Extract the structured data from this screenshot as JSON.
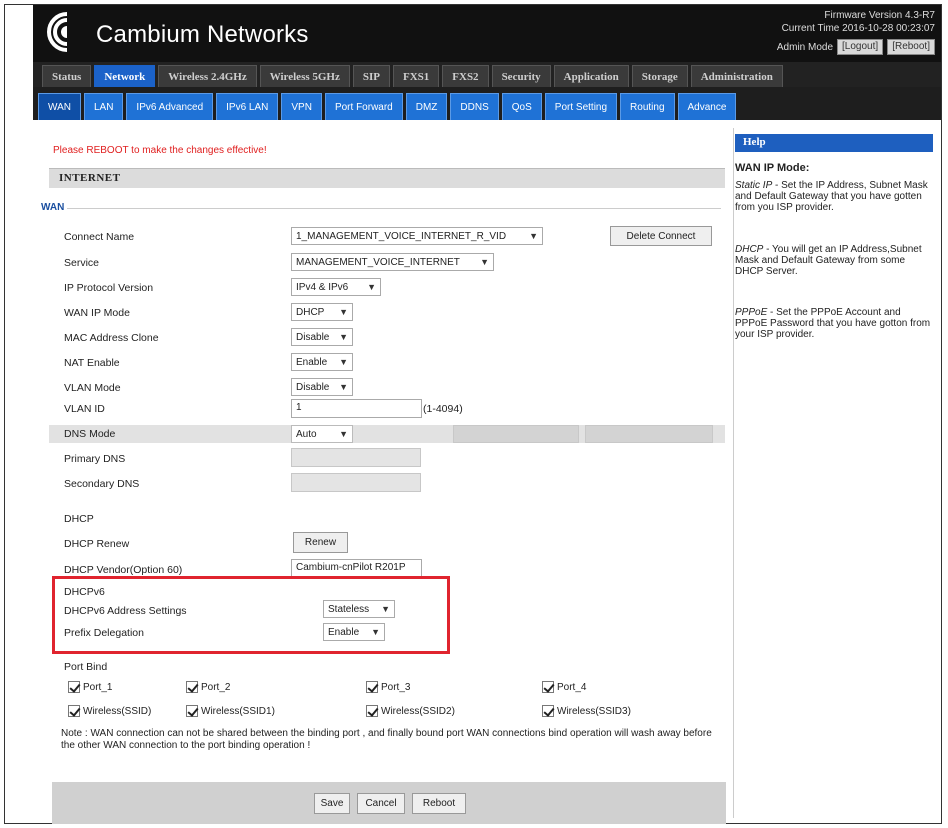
{
  "header": {
    "brand": "Cambium Networks",
    "firmware": "Firmware Version 4.3-R7",
    "current_time": "Current Time 2016-10-28 00:23:07",
    "admin_mode": "Admin Mode",
    "logout_label": "[Logout]",
    "reboot_label": "[Reboot]"
  },
  "main_tabs": [
    {
      "label": "Status",
      "active": false
    },
    {
      "label": "Network",
      "active": true
    },
    {
      "label": "Wireless 2.4GHz",
      "active": false
    },
    {
      "label": "Wireless 5GHz",
      "active": false
    },
    {
      "label": "SIP",
      "active": false
    },
    {
      "label": "FXS1",
      "active": false
    },
    {
      "label": "FXS2",
      "active": false
    },
    {
      "label": "Security",
      "active": false
    },
    {
      "label": "Application",
      "active": false
    },
    {
      "label": "Storage",
      "active": false
    },
    {
      "label": "Administration",
      "active": false
    }
  ],
  "sub_tabs": [
    {
      "label": "WAN",
      "active": true
    },
    {
      "label": "LAN",
      "active": false
    },
    {
      "label": "IPv6 Advanced",
      "active": false
    },
    {
      "label": "IPv6 LAN",
      "active": false
    },
    {
      "label": "VPN",
      "active": false
    },
    {
      "label": "Port Forward",
      "active": false
    },
    {
      "label": "DMZ",
      "active": false
    },
    {
      "label": "DDNS",
      "active": false
    },
    {
      "label": "QoS",
      "active": false
    },
    {
      "label": "Port Setting",
      "active": false
    },
    {
      "label": "Routing",
      "active": false
    },
    {
      "label": "Advance",
      "active": false
    }
  ],
  "content": {
    "reboot_msg": "Please REBOOT to make the changes effective!",
    "section_title": "INTERNET",
    "wan_legend": "WAN",
    "fields": {
      "connect_name": {
        "label": "Connect Name",
        "value": "1_MANAGEMENT_VOICE_INTERNET_R_VID"
      },
      "delete_connect": "Delete Connect",
      "service": {
        "label": "Service",
        "value": "MANAGEMENT_VOICE_INTERNET"
      },
      "ip_protocol": {
        "label": "IP Protocol Version",
        "value": "IPv4 & IPv6"
      },
      "wan_ip_mode": {
        "label": "WAN IP Mode",
        "value": "DHCP"
      },
      "mac_clone": {
        "label": "MAC Address Clone",
        "value": "Disable"
      },
      "nat_enable": {
        "label": "NAT Enable",
        "value": "Enable"
      },
      "vlan_mode": {
        "label": "VLAN Mode",
        "value": "Disable"
      },
      "vlan_id": {
        "label": "VLAN ID",
        "value": "1",
        "hint": "(1-4094)"
      },
      "dns_mode": {
        "label": "DNS Mode",
        "value": "Auto"
      },
      "primary_dns": {
        "label": "Primary DNS"
      },
      "secondary_dns": {
        "label": "Secondary DNS"
      },
      "dhcp": {
        "label": "DHCP"
      },
      "dhcp_renew": {
        "label": "DHCP Renew",
        "button": "Renew"
      },
      "dhcp_vendor": {
        "label": "DHCP Vendor(Option 60)",
        "value": "Cambium-cnPilot R201P"
      },
      "dhcpv6": {
        "label": "DHCPv6"
      },
      "dhcpv6_addr": {
        "label": "DHCPv6 Address Settings",
        "value": "Stateless"
      },
      "prefix_deleg": {
        "label": "Prefix Delegation",
        "value": "Enable"
      },
      "port_bind": {
        "label": "Port Bind"
      }
    },
    "port_bind_items": [
      {
        "label": "Port_1",
        "checked": true
      },
      {
        "label": "Port_2",
        "checked": true
      },
      {
        "label": "Port_3",
        "checked": true
      },
      {
        "label": "Port_4",
        "checked": true
      },
      {
        "label": "Wireless(SSID)",
        "checked": true
      },
      {
        "label": "Wireless(SSID1)",
        "checked": true
      },
      {
        "label": "Wireless(SSID2)",
        "checked": true
      },
      {
        "label": "Wireless(SSID3)",
        "checked": true
      }
    ],
    "note": "Note : WAN connection can not be shared between the binding port , and finally bound port WAN connections bind operation will wash away before the other WAN connection to the port binding operation !",
    "buttons": {
      "save": "Save",
      "cancel": "Cancel",
      "reboot": "Reboot"
    }
  },
  "help": {
    "header": "Help",
    "title": "WAN IP Mode:",
    "static_term": "Static IP",
    "static_text": " - Set the IP Address, Subnet Mask and Default Gateway that you have gotten from you ISP provider.",
    "dhcp_term": "DHCP",
    "dhcp_text": " - You will get an IP Address,Subnet Mask and Default Gateway from some DHCP Server.",
    "pppoe_term": "PPPoE",
    "pppoe_text": " - Set the PPPoE Account and PPPoE Password that you have gotton from your ISP provider."
  },
  "colors": {
    "accent": "#1e5fbf",
    "tab_blue": "#1f72d6",
    "highlight_red": "#e0242e",
    "alert_red": "#e02020"
  }
}
